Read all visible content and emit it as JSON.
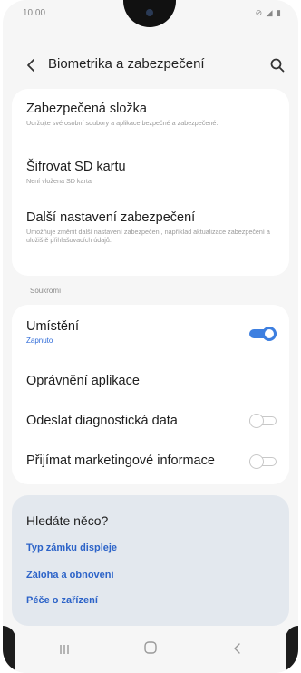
{
  "status_bar": {
    "time": "10:00",
    "icons": "⊘ ◢ ▮"
  },
  "header": {
    "title": "Biometrika a zabezpečení",
    "back_icon": "chevron-left-icon",
    "search_icon": "search-icon"
  },
  "security": {
    "items": [
      {
        "title": "Zabezpečená složka",
        "subtitle": "Udržujte své osobní soubory a aplikace bezpečné a zabezpečené."
      },
      {
        "title": "Šifrovat SD kartu",
        "subtitle": "Není vložena SD karta"
      },
      {
        "title": "Další nastavení zabezpečení",
        "subtitle": "Umožňuje změnit další nastavení zabezpečení, například aktualizace zabezpečení a uložiště přihlašovacích údajů."
      }
    ]
  },
  "privacy": {
    "section_label": "Soukromí",
    "location": {
      "title": "Umístění",
      "status": "Zapnuto",
      "enabled": true
    },
    "app_permissions": {
      "title": "Oprávnění aplikace"
    },
    "diagnostics": {
      "title": "Odeslat diagnostická data",
      "enabled": false
    },
    "marketing": {
      "title": "Přijímat marketingové informace",
      "enabled": false
    }
  },
  "suggestions": {
    "heading": "Hledáte něco?",
    "links": [
      "Typ zámku displeje",
      "Záloha a obnovení",
      "Péče o zařízení"
    ]
  },
  "nav_bar": {
    "recent": "recent-apps-icon",
    "home": "home-icon",
    "back": "back-icon"
  },
  "colors": {
    "accent": "#3d7fe0",
    "link": "#2c63c8",
    "suggest_bg": "#e3e8ee",
    "background": "#f6f6f6"
  }
}
